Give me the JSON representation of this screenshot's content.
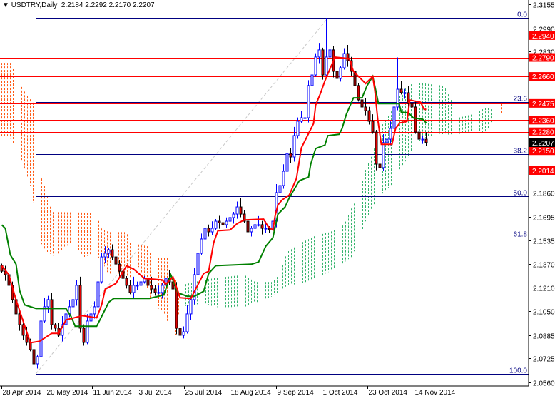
{
  "header": {
    "menu_icon": "triangle-down-icon",
    "symbol": "USDTRY,Daily",
    "ohlc": "2.2184 2.2292 2.2170 2.2207"
  },
  "colors": {
    "bull": "#0000ff",
    "bear_body": "#e00000",
    "tenkan": "#ff0000",
    "kijun": "#008000",
    "cloud_bear": "#ff5a14",
    "cloud_bull": "#33b36b",
    "level": "#ff0000",
    "fib": "#000080",
    "current_price_bg": "#000000"
  },
  "chart_data": {
    "type": "candlestick",
    "title": "USDTRY,Daily",
    "ylim": [
      2.056,
      2.3155
    ],
    "y_ticks": [
      "2.3155",
      "2.2990",
      "2.2830",
      "2.1860",
      "2.1695",
      "2.1535",
      "2.1370",
      "2.1210",
      "2.1050",
      "2.0885",
      "2.0725",
      "2.0560"
    ],
    "x_labels": [
      {
        "bar": 0.4,
        "label": "28 Apr 2014"
      },
      {
        "bar": 12.8,
        "label": "20 May 2014"
      },
      {
        "bar": 25.8,
        "label": "11 Jun 2014"
      },
      {
        "bar": 38.6,
        "label": "3 Jul 2014"
      },
      {
        "bar": 51.6,
        "label": "25 Jul 2014"
      },
      {
        "bar": 64.4,
        "label": "18 Aug 2014"
      },
      {
        "bar": 77.4,
        "label": "9 Sep 2014"
      },
      {
        "bar": 90.2,
        "label": "1 Oct 2014"
      },
      {
        "bar": 103,
        "label": "23 Oct 2014"
      },
      {
        "bar": 116,
        "label": "14 Nov 2014"
      }
    ],
    "first_open": 2.136,
    "closes": [
      2.1323,
      2.1299,
      2.1226,
      2.1128,
      2.103,
      2.0956,
      2.0883,
      2.0834,
      2.0785,
      2.0687,
      2.0736,
      2.0981,
      2.1079,
      2.1128,
      2.0956,
      2.0932,
      2.0883,
      2.0956,
      2.103,
      2.1079,
      2.1128,
      2.1226,
      2.0932,
      2.0834,
      2.0981,
      2.103,
      2.1079,
      2.125,
      2.1421,
      2.1446,
      2.147,
      2.1421,
      2.1372,
      2.1323,
      2.1274,
      2.1226,
      2.1177,
      2.1226,
      2.1226,
      2.125,
      2.1274,
      2.1226,
      2.1201,
      2.1177,
      2.1177,
      2.1226,
      2.1274,
      2.125,
      2.1201,
      2.0932,
      2.0883,
      2.0907,
      2.103,
      2.1128,
      2.1299,
      2.1446,
      2.1544,
      2.1617,
      2.1593,
      2.1617,
      2.1666,
      2.1656,
      2.1642,
      2.1666,
      2.1691,
      2.1715,
      2.1764,
      2.1715,
      2.1666,
      2.1593,
      2.1617,
      2.1642,
      2.1642,
      2.1617,
      2.1617,
      2.1608,
      2.1666,
      2.1862,
      2.1911,
      2.2009,
      2.2131,
      2.2107,
      2.2254,
      2.2352,
      2.2376,
      2.2376,
      2.2597,
      2.267,
      2.2793,
      2.2842,
      2.267,
      2.2793,
      2.2842,
      2.2695,
      2.2646,
      2.2719,
      2.2817,
      2.2768,
      2.2695,
      2.2597,
      2.2499,
      2.245,
      2.2425,
      2.2352,
      2.2278,
      2.2058,
      2.2034,
      2.2205,
      2.2229,
      2.2303,
      2.245,
      2.2572,
      2.2548,
      2.2548,
      2.2474,
      2.245,
      2.2278,
      2.2229,
      2.2229,
      2.2207
    ],
    "extremes": [
      {
        "bar": 9,
        "low": 2.062
      },
      {
        "bar": 91,
        "high": 2.306
      },
      {
        "bar": 111,
        "high": 2.279
      }
    ],
    "tenkan": [
      [
        0,
        2.1361
      ],
      [
        2,
        2.1298
      ],
      [
        4,
        2.1126
      ],
      [
        6,
        2.0979
      ],
      [
        8,
        2.0832
      ],
      [
        10.6,
        2.0842
      ],
      [
        14,
        2.0896
      ],
      [
        16,
        2.0896
      ],
      [
        18,
        2.0989
      ],
      [
        22.6,
        2.1018
      ],
      [
        26.6,
        2.1003
      ],
      [
        28,
        2.1092
      ],
      [
        29,
        2.12
      ],
      [
        32,
        2.1239
      ],
      [
        35,
        2.1361
      ],
      [
        37,
        2.1337
      ],
      [
        40,
        2.1273
      ],
      [
        45,
        2.1263
      ],
      [
        46,
        2.1234
      ],
      [
        48,
        2.1283
      ],
      [
        50,
        2.1141
      ],
      [
        53,
        2.1136
      ],
      [
        56.6,
        2.1307
      ],
      [
        58,
        2.1322
      ],
      [
        59.4,
        2.1518
      ],
      [
        60.6,
        2.1601
      ],
      [
        64,
        2.1606
      ],
      [
        66,
        2.165
      ],
      [
        68,
        2.1675
      ],
      [
        73.4,
        2.168
      ],
      [
        74.6,
        2.1631
      ],
      [
        76,
        2.1606
      ],
      [
        76.6,
        2.1699
      ],
      [
        77.4,
        2.1778
      ],
      [
        78.6,
        2.1812
      ],
      [
        80.6,
        2.1846
      ],
      [
        82.6,
        2.1959
      ],
      [
        84,
        2.217
      ],
      [
        86,
        2.2268
      ],
      [
        87.4,
        2.2336
      ],
      [
        88,
        2.2464
      ],
      [
        89.4,
        2.2547
      ],
      [
        90.6,
        2.263
      ],
      [
        93.4,
        2.2792
      ],
      [
        97.4,
        2.2782
      ],
      [
        98.6,
        2.2694
      ],
      [
        100,
        2.266
      ],
      [
        102,
        2.2611
      ],
      [
        104,
        2.266
      ],
      [
        104.6,
        2.2562
      ],
      [
        105.4,
        2.2366
      ],
      [
        106.4,
        2.2194
      ],
      [
        109.4,
        2.2194
      ],
      [
        110.4,
        2.2302
      ],
      [
        111.6,
        2.2341
      ],
      [
        113.6,
        2.2351
      ],
      [
        114.4,
        2.2498
      ],
      [
        117.4,
        2.2483
      ],
      [
        118.4,
        2.2434
      ],
      [
        119,
        2.2434
      ]
    ],
    "kijun": [
      [
        0,
        2.1641
      ],
      [
        1,
        2.1616
      ],
      [
        2.4,
        2.1435
      ],
      [
        4,
        2.1371
      ],
      [
        5,
        2.119
      ],
      [
        6.4,
        2.1092
      ],
      [
        9.6,
        2.1067
      ],
      [
        18,
        2.1067
      ],
      [
        19.4,
        2.1013
      ],
      [
        20.6,
        2.0945
      ],
      [
        26.6,
        2.0945
      ],
      [
        28,
        2.1013
      ],
      [
        30,
        2.1111
      ],
      [
        31.4,
        2.1136
      ],
      [
        41.4,
        2.1136
      ],
      [
        45.4,
        2.116
      ],
      [
        47.4,
        2.1298
      ],
      [
        49.4,
        2.1175
      ],
      [
        52,
        2.1151
      ],
      [
        54,
        2.1151
      ],
      [
        56.6,
        2.1185
      ],
      [
        58,
        2.1307
      ],
      [
        60,
        2.1361
      ],
      [
        70,
        2.1371
      ],
      [
        72,
        2.1386
      ],
      [
        74,
        2.1494
      ],
      [
        76,
        2.1552
      ],
      [
        77.4,
        2.1714
      ],
      [
        79.4,
        2.1763
      ],
      [
        80.6,
        2.1827
      ],
      [
        83.4,
        2.1944
      ],
      [
        86,
        2.1969
      ],
      [
        86.6,
        2.2057
      ],
      [
        88,
        2.2165
      ],
      [
        90.6,
        2.2189
      ],
      [
        91.4,
        2.2253
      ],
      [
        94.6,
        2.2263
      ],
      [
        95.4,
        2.2302
      ],
      [
        96.6,
        2.24
      ],
      [
        98.6,
        2.2513
      ],
      [
        101,
        2.2513
      ],
      [
        102.4,
        2.2596
      ],
      [
        104,
        2.266
      ],
      [
        105,
        2.2547
      ],
      [
        105.6,
        2.2473
      ],
      [
        111.4,
        2.2473
      ],
      [
        112,
        2.2415
      ],
      [
        114,
        2.241
      ],
      [
        115.4,
        2.2375
      ],
      [
        118,
        2.2366
      ],
      [
        119,
        2.2341
      ]
    ],
    "cloud_bear": {
      "upper": [
        [
          0,
          2.2753
        ],
        [
          2.4,
          2.2753
        ],
        [
          5,
          2.2611
        ],
        [
          7,
          2.2532
        ],
        [
          9,
          2.2474
        ],
        [
          10,
          2.2033
        ],
        [
          12,
          2.191
        ],
        [
          14,
          2.1729
        ],
        [
          26,
          2.1724
        ],
        [
          27,
          2.168
        ],
        [
          28,
          2.1616
        ],
        [
          30,
          2.1591
        ],
        [
          35,
          2.1591
        ],
        [
          36,
          2.1518
        ],
        [
          41,
          2.1493
        ],
        [
          42,
          2.142
        ],
        [
          48,
          2.141
        ],
        [
          49,
          2.1224
        ],
        [
          50,
          2.1126
        ]
      ],
      "lower": [
        [
          0,
          2.2253
        ],
        [
          2,
          2.2253
        ],
        [
          3,
          2.2204
        ],
        [
          5,
          2.2131
        ],
        [
          8,
          2.191
        ],
        [
          9,
          2.1763
        ],
        [
          10,
          2.1567
        ],
        [
          12,
          2.1469
        ],
        [
          15,
          2.142
        ],
        [
          18,
          2.1494
        ],
        [
          20,
          2.1518
        ],
        [
          23,
          2.142
        ],
        [
          26,
          2.1445
        ],
        [
          28,
          2.1396
        ],
        [
          30,
          2.1298
        ],
        [
          34,
          2.1298
        ],
        [
          36,
          2.1273
        ],
        [
          38,
          2.1371
        ],
        [
          40,
          2.1273
        ],
        [
          42,
          2.11
        ],
        [
          45,
          2.105
        ],
        [
          48,
          2.09
        ],
        [
          49,
          2.0881
        ],
        [
          50,
          2.1126
        ]
      ]
    },
    "cloud_bull": {
      "upper": [
        [
          50,
          2.1224
        ],
        [
          54,
          2.1249
        ],
        [
          59,
          2.1273
        ],
        [
          68,
          2.1298
        ],
        [
          71,
          2.1249
        ],
        [
          76,
          2.1249
        ],
        [
          78,
          2.1307
        ],
        [
          80,
          2.1454
        ],
        [
          84,
          2.1518
        ],
        [
          88,
          2.1567
        ],
        [
          92,
          2.1591
        ],
        [
          96,
          2.1641
        ],
        [
          98,
          2.1753
        ],
        [
          100,
          2.1837
        ],
        [
          102,
          2.2018
        ],
        [
          104,
          2.2131
        ],
        [
          106,
          2.2302
        ],
        [
          108,
          2.2376
        ],
        [
          110,
          2.2449
        ],
        [
          112,
          2.2547
        ],
        [
          114,
          2.2596
        ],
        [
          116,
          2.2621
        ],
        [
          120,
          2.2606
        ],
        [
          124,
          2.2596
        ],
        [
          126,
          2.2498
        ],
        [
          128,
          2.2376
        ],
        [
          132,
          2.24
        ],
        [
          136,
          2.2449
        ],
        [
          138,
          2.2425
        ],
        [
          139,
          2.2425
        ]
      ],
      "lower": [
        [
          50,
          2.1077
        ],
        [
          56,
          2.1101
        ],
        [
          60,
          2.1077
        ],
        [
          68,
          2.1077
        ],
        [
          76,
          2.1151
        ],
        [
          80,
          2.1224
        ],
        [
          86,
          2.1249
        ],
        [
          90,
          2.1298
        ],
        [
          94,
          2.1347
        ],
        [
          98,
          2.142
        ],
        [
          100,
          2.1518
        ],
        [
          102,
          2.1665
        ],
        [
          104,
          2.1763
        ],
        [
          106,
          2.1837
        ],
        [
          108,
          2.1886
        ],
        [
          110,
          2.1935
        ],
        [
          112,
          2.2033
        ],
        [
          114,
          2.2106
        ],
        [
          116,
          2.2204
        ],
        [
          120,
          2.2253
        ],
        [
          136,
          2.2278
        ],
        [
          138,
          2.2376
        ],
        [
          139,
          2.24
        ]
      ]
    },
    "cloud_bear_end": {
      "upper": [
        [
          139.4,
          2.2473
        ],
        [
          140.2,
          2.2473
        ]
      ],
      "lower": [
        [
          139.4,
          2.24
        ],
        [
          140.2,
          2.24
        ]
      ]
    },
    "levels": [
      "2.2940",
      "2.2790",
      "2.2660",
      "2.2475",
      "2.2360",
      "2.2280",
      "2.2150",
      "2.2014"
    ],
    "current_price": "2.2207",
    "fibonacci": {
      "start_bar": 9.6,
      "end_bar": 91.4,
      "high": 2.306,
      "low": 2.062,
      "levels": [
        {
          "label": "0.0",
          "ratio": 0
        },
        {
          "label": "23.6",
          "ratio": 0.236
        },
        {
          "label": "38.2",
          "ratio": 0.382
        },
        {
          "label": "50.0",
          "ratio": 0.5
        },
        {
          "label": "61.8",
          "ratio": 0.618
        },
        {
          "label": "100.0",
          "ratio": 1
        }
      ]
    }
  }
}
